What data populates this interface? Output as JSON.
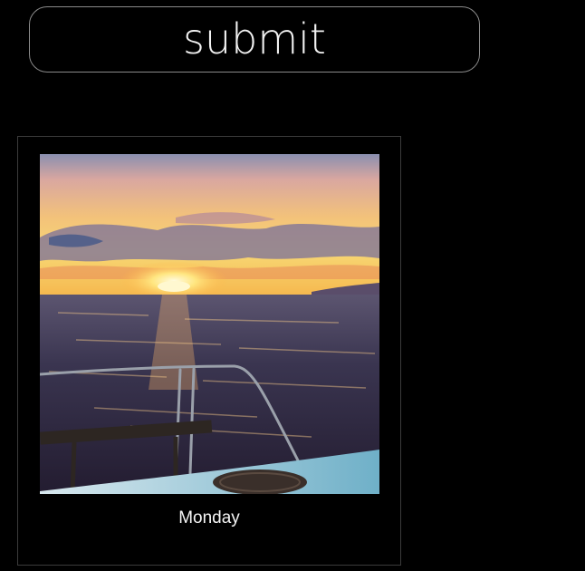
{
  "submit": {
    "label": "submit"
  },
  "card": {
    "caption": "Monday",
    "photo_icon": "sunset-over-ocean-photo"
  },
  "colors": {
    "background": "#000000",
    "button_border": "#8a8a8a",
    "card_border": "#3b3b3b",
    "text": "#f2f2f2"
  }
}
